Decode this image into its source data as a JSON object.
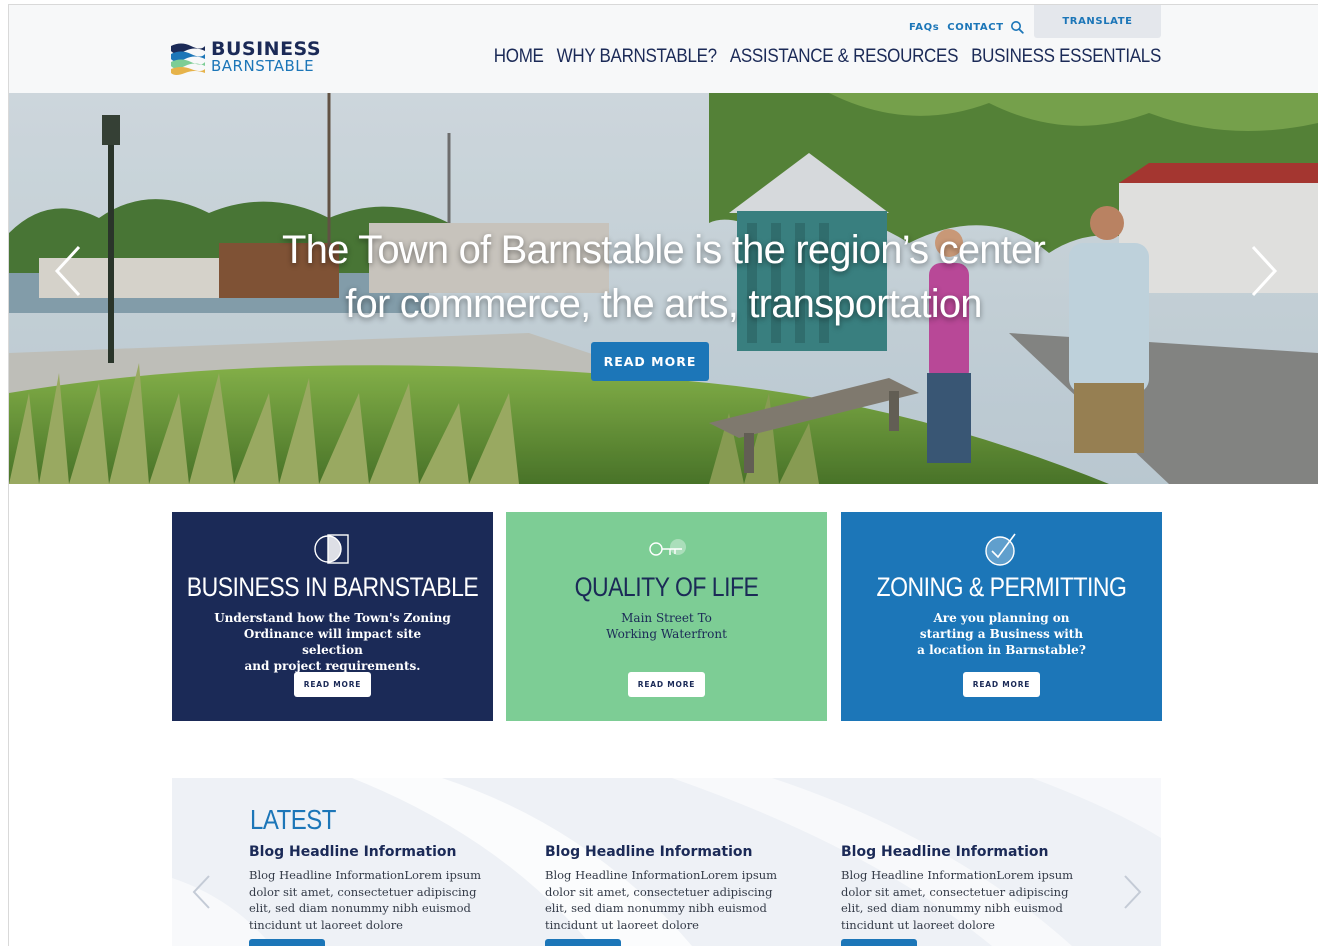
{
  "header": {
    "logo": {
      "line1": "BUSINESS",
      "line2": "BARNSTABLE"
    },
    "utility_nav": [
      {
        "label": "FAQs"
      },
      {
        "label": "CONTACT"
      }
    ],
    "translate_label": "TRANSLATE",
    "main_nav": [
      {
        "label": "HOME"
      },
      {
        "label": "WHY BARNSTABLE?"
      },
      {
        "label": "ASSISTANCE & RESOURCES"
      },
      {
        "label": "BUSINESS ESSENTIALS"
      }
    ]
  },
  "hero": {
    "title_line1": "The Town of Barnstable is the region’s center",
    "title_line2": "for commerce, the arts, transportation",
    "button_label": "READ MORE"
  },
  "cards": [
    {
      "title": "BUSINESS IN BARNSTABLE",
      "desc_lines": [
        "Understand how the Town's Zoning",
        "Ordinance will impact site selection",
        "and project requirements."
      ],
      "button_label": "READ MORE",
      "icon": "overlapping-shapes-icon"
    },
    {
      "title": "QUALITY OF LIFE",
      "desc_lines": [
        "Main Street To",
        "Working Waterfront"
      ],
      "button_label": "READ MORE",
      "icon": "key-icon"
    },
    {
      "title": "ZONING & PERMITTING",
      "desc_lines": [
        "Are you planning on",
        "starting a Business with",
        "a location in Barnstable?"
      ],
      "button_label": "READ MORE",
      "icon": "check-circle-icon"
    }
  ],
  "latest": {
    "title": "LATEST",
    "posts": [
      {
        "headline": "Blog Headline Information",
        "body_lines": [
          "Blog Headline InformationLorem ipsum",
          "dolor sit amet, consectetuer adipiscing",
          "elit, sed diam nonummy nibh euismod",
          "tincidunt ut laoreet dolore"
        ]
      },
      {
        "headline": "Blog Headline Information",
        "body_lines": [
          "Blog Headline InformationLorem ipsum",
          "dolor sit amet, consectetuer adipiscing",
          "elit, sed diam nonummy nibh euismod",
          "tincidunt ut laoreet dolore"
        ]
      },
      {
        "headline": "Blog Headline Information",
        "body_lines": [
          "Blog Headline InformationLorem ipsum",
          "dolor sit amet, consectetuer adipiscing",
          "elit, sed diam nonummy nibh euismod",
          "tincidunt ut laoreet dolore"
        ]
      }
    ]
  },
  "colors": {
    "navy": "#1b2a57",
    "blue": "#1c76b8",
    "green": "#7dcd95",
    "header_bg": "#f7f8f9",
    "latest_bg": "#eef1f6"
  },
  "icons": {
    "search": "search-icon",
    "hero_prev": "chevron-left-icon",
    "hero_next": "chevron-right-icon",
    "latest_prev": "chevron-left-icon",
    "latest_next": "chevron-right-icon"
  }
}
